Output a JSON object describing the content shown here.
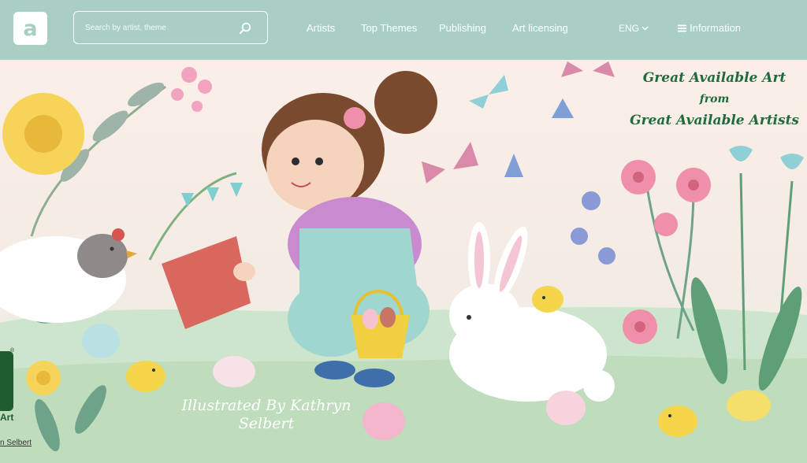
{
  "logo": {
    "letter": "a"
  },
  "search": {
    "placeholder": "Search by artist, theme",
    "icon": "search-icon"
  },
  "nav": {
    "items": [
      {
        "label": "Artists"
      },
      {
        "label": "Top Themes"
      },
      {
        "label": "Publishing"
      },
      {
        "label": "Art licensing"
      }
    ]
  },
  "language": {
    "label": "ENG",
    "icon": "chevron-down-icon"
  },
  "info": {
    "label": "Information",
    "icon": "menu-icon"
  },
  "hero": {
    "tagline": [
      "Great Available Art",
      "from",
      "Great Available Artists"
    ],
    "credit": "Illustrated By Kathryn Selbert"
  },
  "side": {
    "reg": "®",
    "art_label": "Art",
    "link_text": "n Selbert"
  },
  "colors": {
    "header": "#a9cfc5",
    "tagline": "#1f6b3c",
    "badge": "#1f5c30"
  }
}
